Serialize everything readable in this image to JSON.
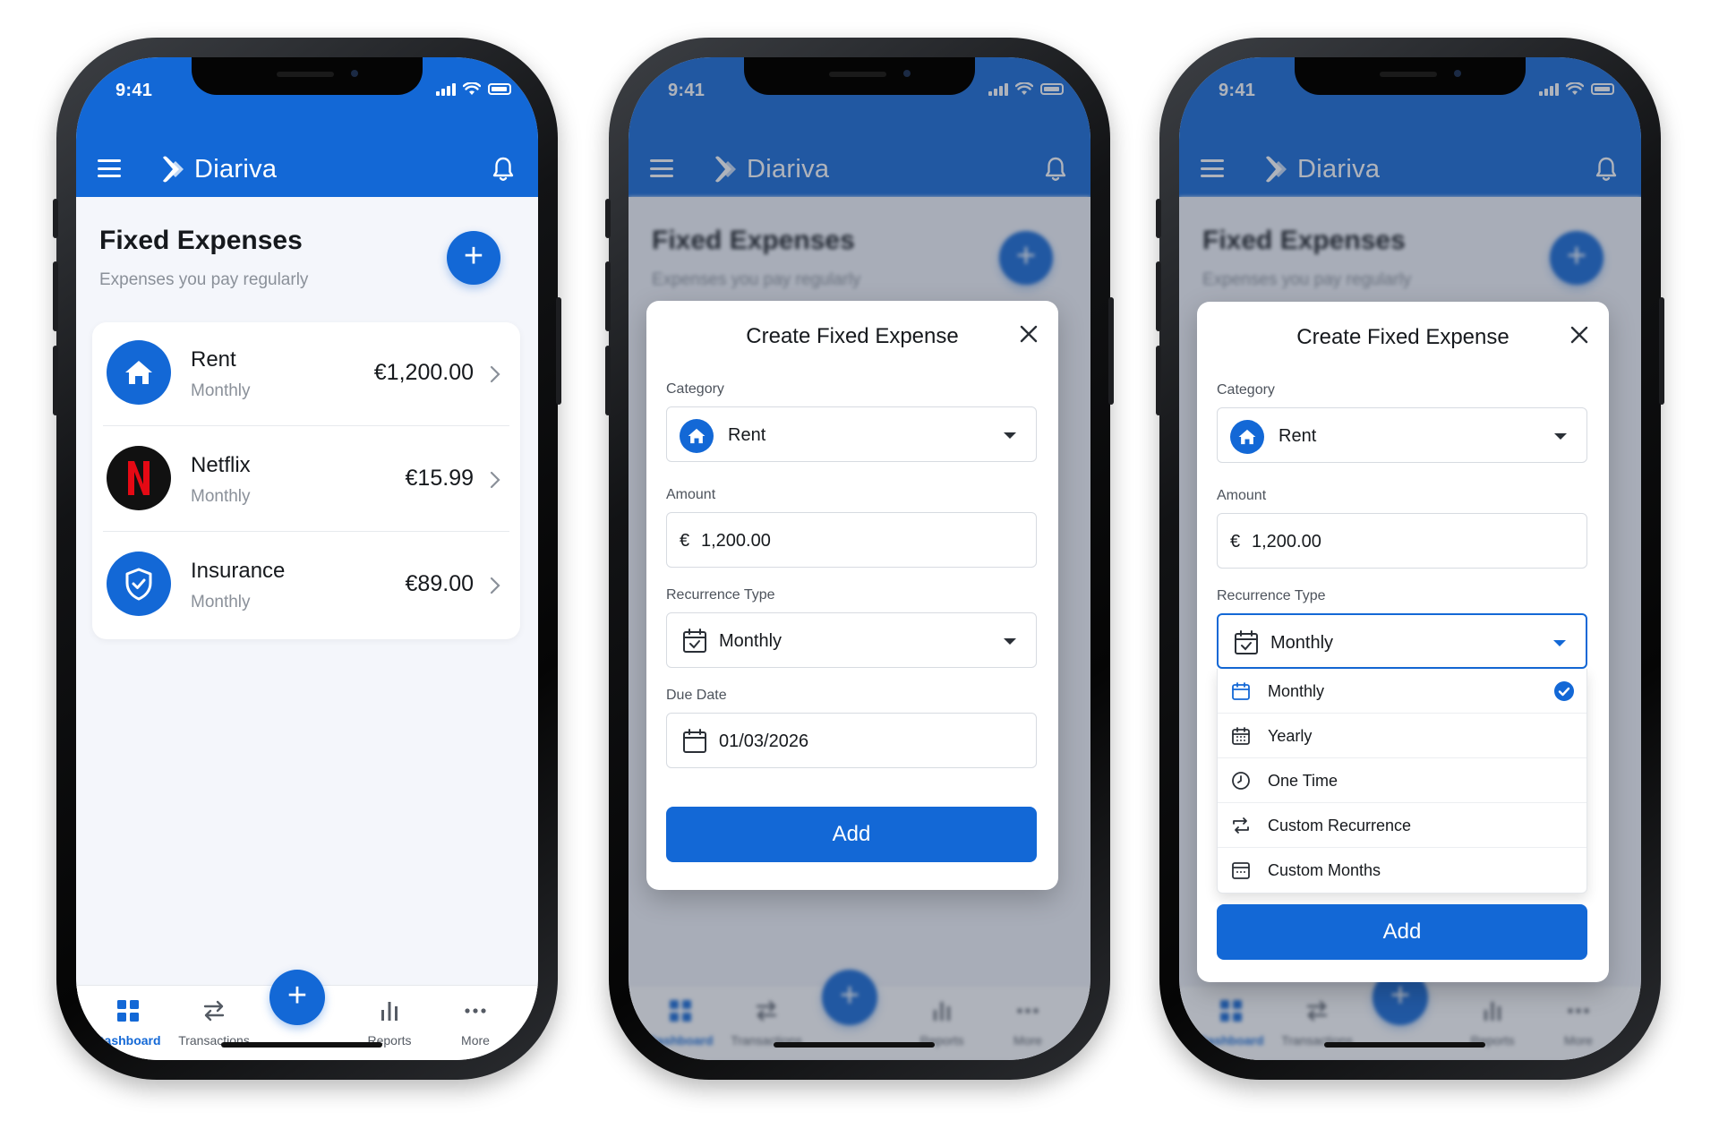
{
  "status": {
    "time": "9:41"
  },
  "app": {
    "name": "Diariva"
  },
  "page": {
    "title": "Fixed Expenses",
    "subtitle": "Expenses you pay regularly"
  },
  "expenses": [
    {
      "name": "Rent",
      "frequency": "Monthly",
      "amount": "€1,200.00",
      "icon": "house-icon",
      "color": "#1368d6"
    },
    {
      "name": "Netflix",
      "frequency": "Monthly",
      "amount": "€15.99",
      "icon": "netflix-logo",
      "color": "#111111"
    },
    {
      "name": "Insurance",
      "frequency": "Monthly",
      "amount": "€89.00",
      "icon": "shield-icon",
      "color": "#1368d6"
    }
  ],
  "nav": [
    {
      "label": "Dashboard",
      "icon": "dashboard-icon",
      "active": true
    },
    {
      "label": "Transactions",
      "icon": "transfer-icon",
      "active": false
    },
    {
      "label": "Reports",
      "icon": "bar-chart-icon",
      "active": false
    },
    {
      "label": "More",
      "icon": "more-icon",
      "active": false
    }
  ],
  "nav_fab": "+",
  "modal": {
    "title": "Create Fixed Expense",
    "category_label": "Category",
    "category_value": "Rent",
    "amount_label": "Amount",
    "amount_currency": "€",
    "amount_value": "1,200.00",
    "recurrence_label": "Recurrence Type",
    "recurrence_value": "Monthly",
    "due_date_label": "Due Date",
    "due_date_value": "01/03/2026",
    "add_label": "Add"
  },
  "recurrence_options": [
    {
      "label": "Monthly",
      "icon": "calendar-icon",
      "selected": true
    },
    {
      "label": "Yearly",
      "icon": "calendar-grid-icon",
      "selected": false
    },
    {
      "label": "One Time",
      "icon": "clock-icon",
      "selected": false
    },
    {
      "label": "Custom Recurrence",
      "icon": "repeat-icon",
      "selected": false
    },
    {
      "label": "Custom Months",
      "icon": "calendar-dots-icon",
      "selected": false
    }
  ],
  "colors": {
    "primary": "#1368d6",
    "background": "#f4f6fb",
    "netflix_red": "#e50914"
  }
}
